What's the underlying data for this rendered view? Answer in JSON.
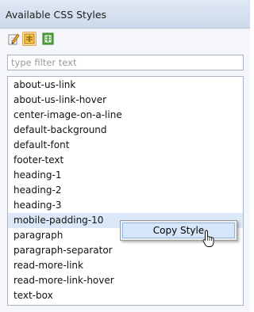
{
  "panel": {
    "title": "Available CSS Styles"
  },
  "toolbar": {
    "buttons": [
      {
        "icon": "edit-style-icon",
        "active": false
      },
      {
        "icon": "show-list-icon",
        "active": true
      },
      {
        "icon": "import-styles-icon",
        "active": false
      }
    ]
  },
  "filter": {
    "value": "",
    "placeholder": "type filter text"
  },
  "styles": {
    "items": [
      "about-us-link",
      "about-us-link-hover",
      "center-image-on-a-line",
      "default-background",
      "default-font",
      "footer-text",
      "heading-1",
      "heading-2",
      "heading-3",
      "mobile-padding-10",
      "paragraph",
      "paragraph-separator",
      "read-more-link",
      "read-more-link-hover",
      "text-box"
    ],
    "selected": "mobile-padding-10"
  },
  "context_menu": {
    "items": [
      "Copy Style"
    ],
    "hovered": "Copy Style"
  },
  "colors": {
    "header_bg": "#d6e0ee",
    "selection": "#dbe8f8",
    "menu_hover": "#d6e7fb",
    "menu_hover_border": "#8cb7ea"
  }
}
